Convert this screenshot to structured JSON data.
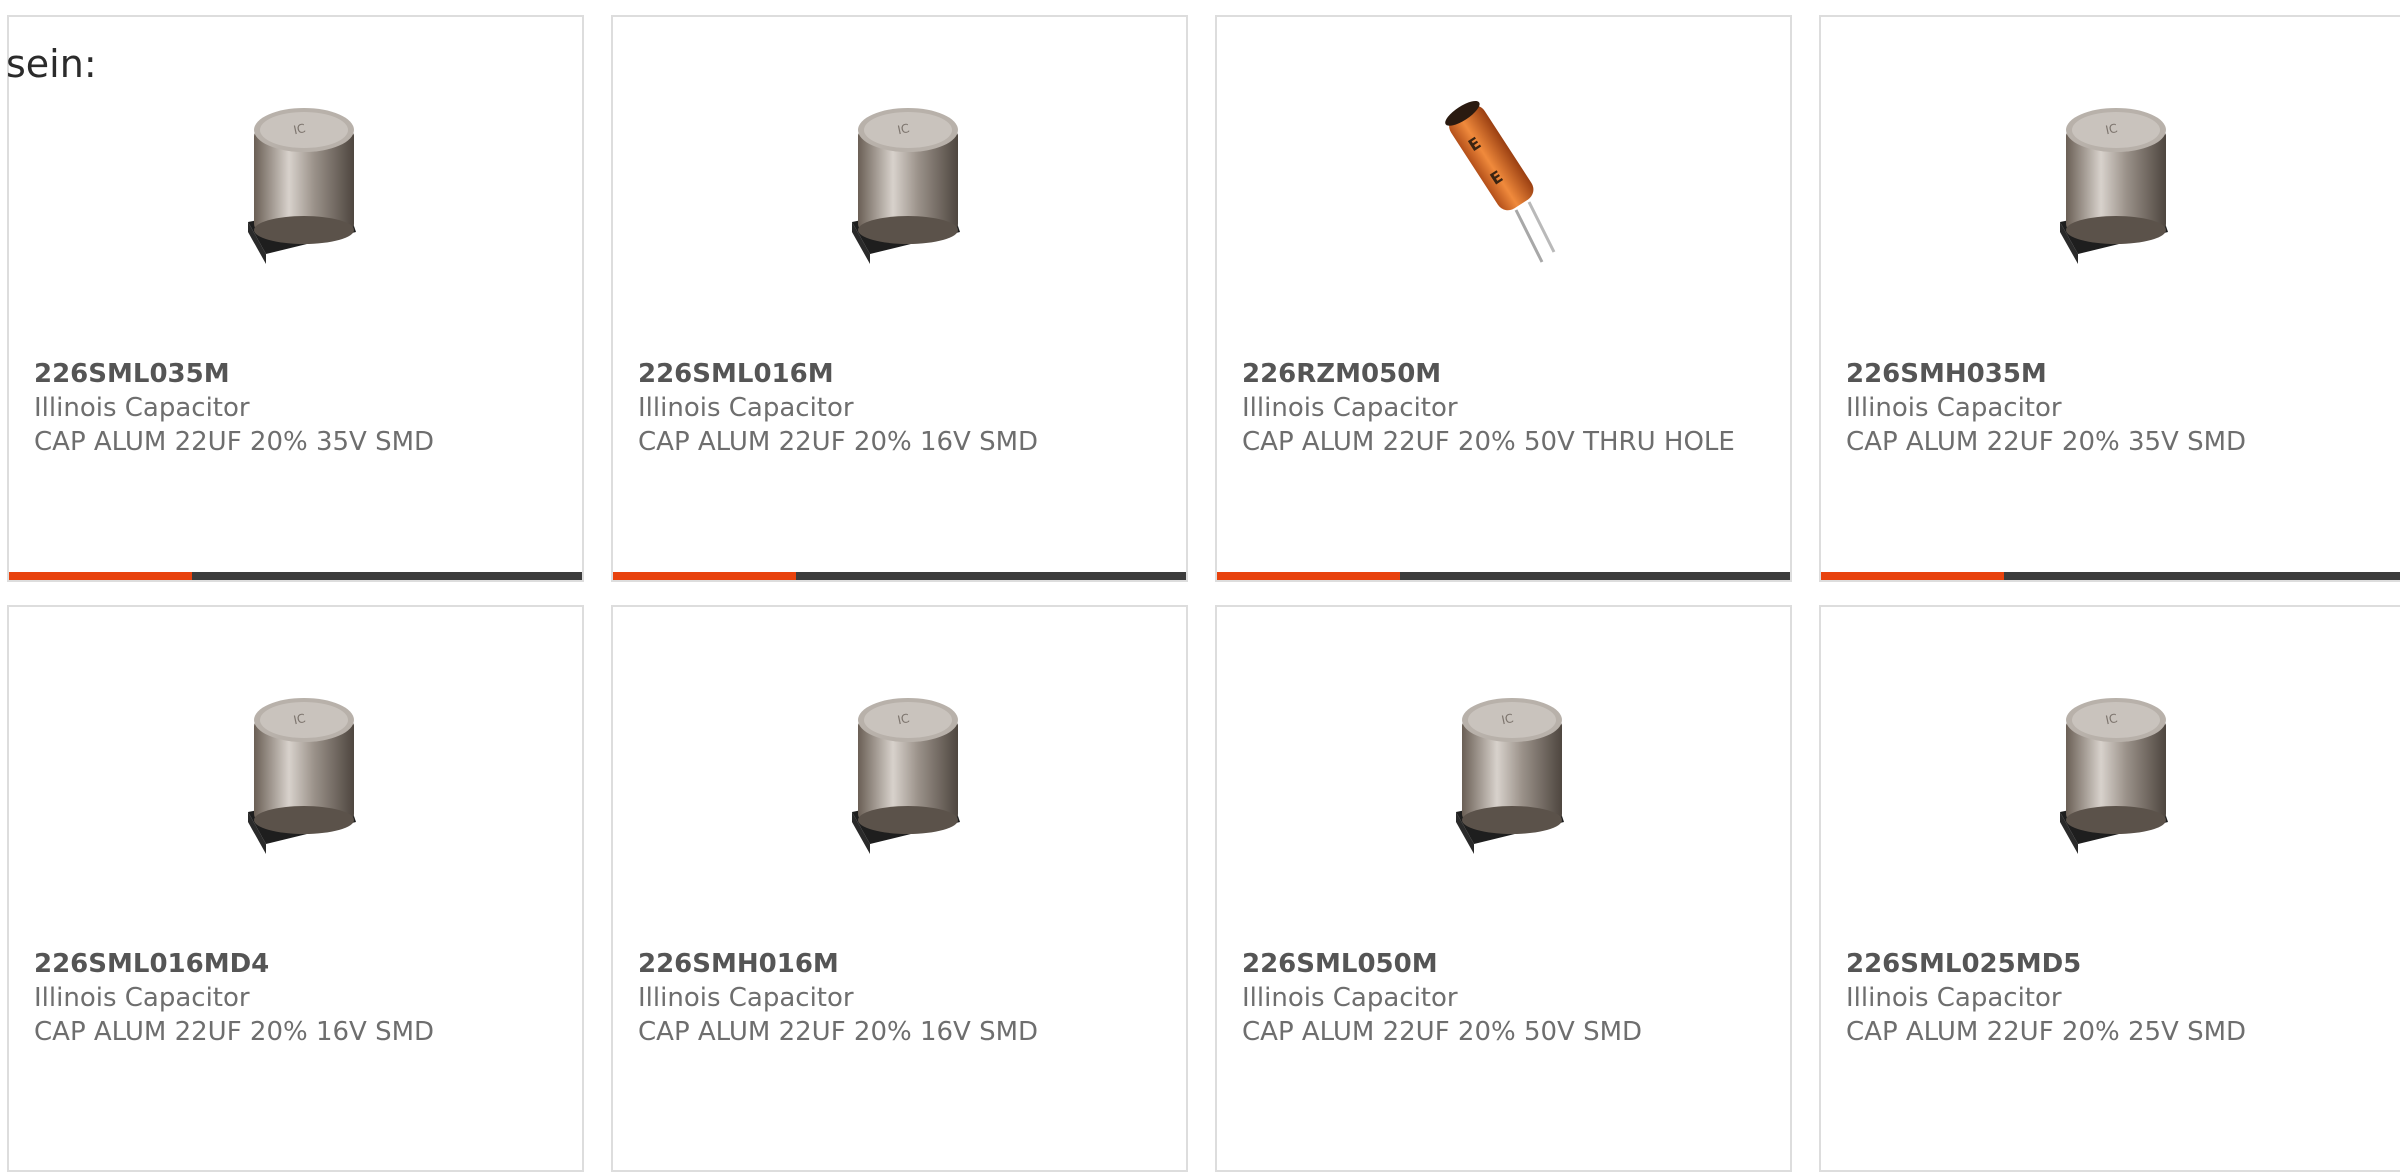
{
  "intro_text": "sein:",
  "accent_color": "#e8420d",
  "bar_track_color": "#3c3c3c",
  "products": [
    {
      "part_number": "226SML035M",
      "manufacturer": "Illinois Capacitor",
      "description": "CAP ALUM 22UF 20% 35V SMD",
      "image_icon": "smd-capacitor-image",
      "show_bar": true,
      "bar_progress": 0.32
    },
    {
      "part_number": "226SML016M",
      "manufacturer": "Illinois Capacitor",
      "description": "CAP ALUM 22UF 20% 16V SMD",
      "image_icon": "smd-capacitor-image",
      "show_bar": true,
      "bar_progress": 0.32
    },
    {
      "part_number": "226RZM050M",
      "manufacturer": "Illinois Capacitor",
      "description": "CAP ALUM 22UF 20% 50V THRU HOLE",
      "image_icon": "radial-capacitor-image",
      "show_bar": true,
      "bar_progress": 0.32
    },
    {
      "part_number": "226SMH035M",
      "manufacturer": "Illinois Capacitor",
      "description": "CAP ALUM 22UF 20% 35V SMD",
      "image_icon": "smd-capacitor-image",
      "show_bar": true,
      "bar_progress": 0.32
    },
    {
      "part_number": "226SML016MD4",
      "manufacturer": "Illinois Capacitor",
      "description": "CAP ALUM 22UF 20% 16V SMD",
      "image_icon": "smd-capacitor-image",
      "show_bar": false,
      "bar_progress": 0
    },
    {
      "part_number": "226SMH016M",
      "manufacturer": "Illinois Capacitor",
      "description": "CAP ALUM 22UF 20% 16V SMD",
      "image_icon": "smd-capacitor-image",
      "show_bar": false,
      "bar_progress": 0
    },
    {
      "part_number": "226SML050M",
      "manufacturer": "Illinois Capacitor",
      "description": "CAP ALUM 22UF 20% 50V SMD",
      "image_icon": "smd-capacitor-image",
      "show_bar": false,
      "bar_progress": 0
    },
    {
      "part_number": "226SML025MD5",
      "manufacturer": "Illinois Capacitor",
      "description": "CAP ALUM 22UF 20% 25V SMD",
      "image_icon": "smd-capacitor-image",
      "show_bar": false,
      "bar_progress": 0
    }
  ]
}
